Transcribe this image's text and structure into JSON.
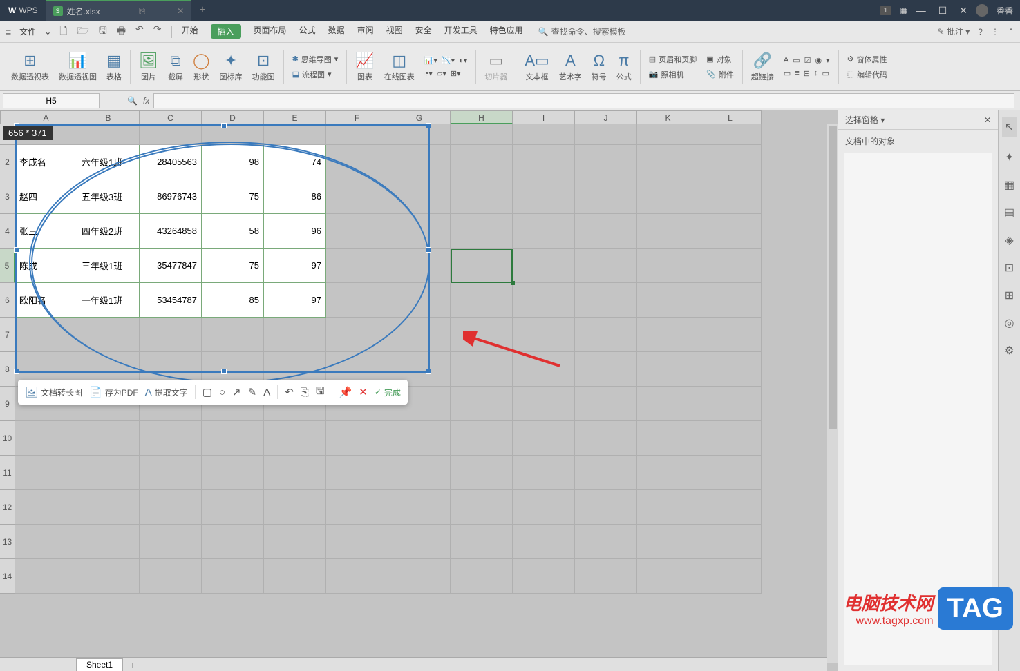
{
  "titlebar": {
    "app": "WPS",
    "tab_name": "姓名.xlsx",
    "badge": "1",
    "user": "香香"
  },
  "menubar": {
    "file": "文件",
    "tabs": [
      "开始",
      "插入",
      "页面布局",
      "公式",
      "数据",
      "审阅",
      "视图",
      "安全",
      "开发工具",
      "特色应用"
    ],
    "search_placeholder": "查找命令、搜索模板",
    "annotate": "批注"
  },
  "ribbon": {
    "pivot_table": "数据透视表",
    "pivot_chart": "数据透视图",
    "table": "表格",
    "picture": "图片",
    "screenshot": "截屏",
    "shapes": "形状",
    "icons": "图标库",
    "smartart": "功能图",
    "mindmap": "思维导图",
    "flowchart": "流程图",
    "chart": "图表",
    "online_chart": "在线图表",
    "textbox": "文本框",
    "wordart": "艺术字",
    "symbol": "符号",
    "equation": "公式",
    "slicer": "切片器",
    "camera": "照相机",
    "header_footer": "页眉和页脚",
    "object": "对象",
    "attachment": "附件",
    "hyperlink": "超链接",
    "form_props": "窗体属性",
    "edit_code": "编辑代码"
  },
  "formula": {
    "cell_ref": "H5"
  },
  "columns": [
    "A",
    "B",
    "C",
    "D",
    "E",
    "F",
    "G",
    "H",
    "I",
    "J",
    "K",
    "L"
  ],
  "rows": [
    "1",
    "2",
    "3",
    "4",
    "5",
    "6",
    "7",
    "8",
    "9",
    "10",
    "11",
    "12",
    "13",
    "14"
  ],
  "selection_dim": "656 * 371",
  "table_data": [
    {
      "name": "李成名",
      "class": "六年级1班",
      "id": "28405563",
      "s1": "98",
      "s2": "74"
    },
    {
      "name": "赵四",
      "class": "五年级3班",
      "id": "86976743",
      "s1": "75",
      "s2": "86"
    },
    {
      "name": "张三",
      "class": "四年级2班",
      "id": "43264858",
      "s1": "58",
      "s2": "96"
    },
    {
      "name": "陈成",
      "class": "三年级1班",
      "id": "35477847",
      "s1": "75",
      "s2": "97"
    },
    {
      "name": "欧阳名",
      "class": "一年级1班",
      "id": "53454787",
      "s1": "85",
      "s2": "97"
    }
  ],
  "anno": {
    "doc_long": "文档转长图",
    "save_pdf": "存为PDF",
    "extract_text": "提取文字",
    "done": "完成"
  },
  "right_panel": {
    "title": "选择窗格",
    "sub": "文档中的对象"
  },
  "sheet": {
    "name": "Sheet1"
  },
  "watermark": {
    "line1": "电脑技术网",
    "line2": "www.tagxp.com",
    "tag": "TAG"
  }
}
